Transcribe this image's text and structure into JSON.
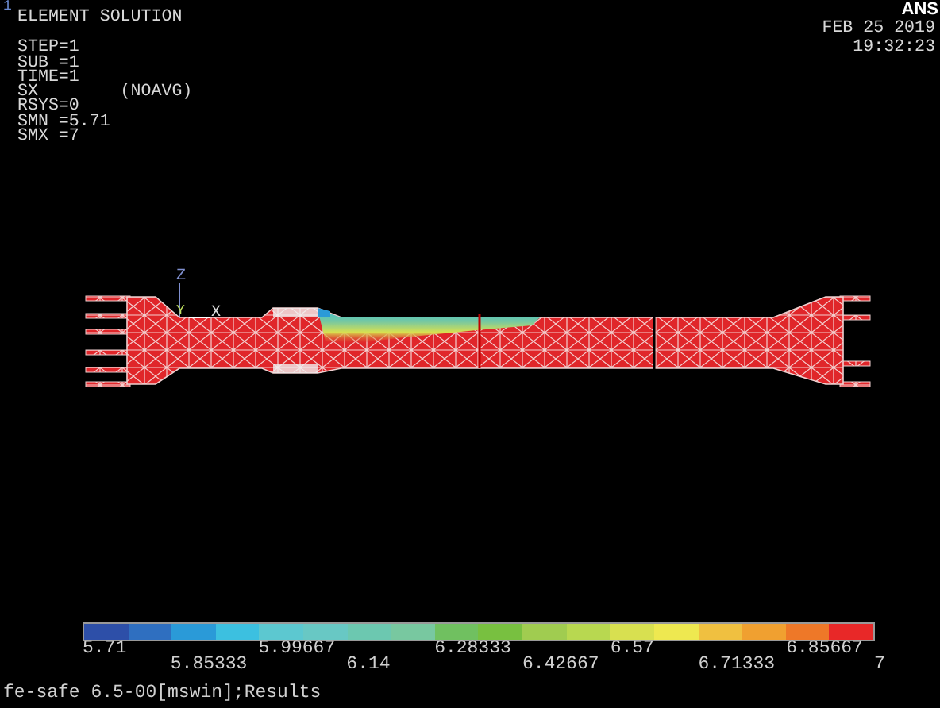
{
  "plot_number": "1",
  "title": "ELEMENT SOLUTION",
  "info_lines": [
    "STEP=1",
    "SUB =1",
    "TIME=1",
    "SX        (NOAVG)",
    "RSYS=0",
    "SMN =5.71",
    "SMX =7"
  ],
  "brand": "ANS",
  "date": "FEB 25 2019",
  "time": "19:32:23",
  "axes": {
    "z": "Z",
    "y": "Y",
    "x": "X"
  },
  "legend": {
    "bands": [
      {
        "color": "#2d4fa8"
      },
      {
        "color": "#2f6fc0"
      },
      {
        "color": "#2a9ad8"
      },
      {
        "color": "#3cc0e0"
      },
      {
        "color": "#5cc8d0"
      },
      {
        "color": "#68c8c4"
      },
      {
        "color": "#6cc8b0"
      },
      {
        "color": "#78c8a0"
      },
      {
        "color": "#70c060"
      },
      {
        "color": "#78c040"
      },
      {
        "color": "#a0cc50"
      },
      {
        "color": "#b8d850"
      },
      {
        "color": "#d8e050"
      },
      {
        "color": "#eee850"
      },
      {
        "color": "#f0c040"
      },
      {
        "color": "#f0a030"
      },
      {
        "color": "#ee7828"
      },
      {
        "color": "#e82828"
      }
    ],
    "labels": [
      "5.71",
      "5.85333",
      "5.99667",
      "6.14",
      "6.28333",
      "6.42667",
      "6.57",
      "6.71333",
      "6.85667",
      "7"
    ]
  },
  "status_bar": "fe-safe 6.5-00[mswin];Results"
}
